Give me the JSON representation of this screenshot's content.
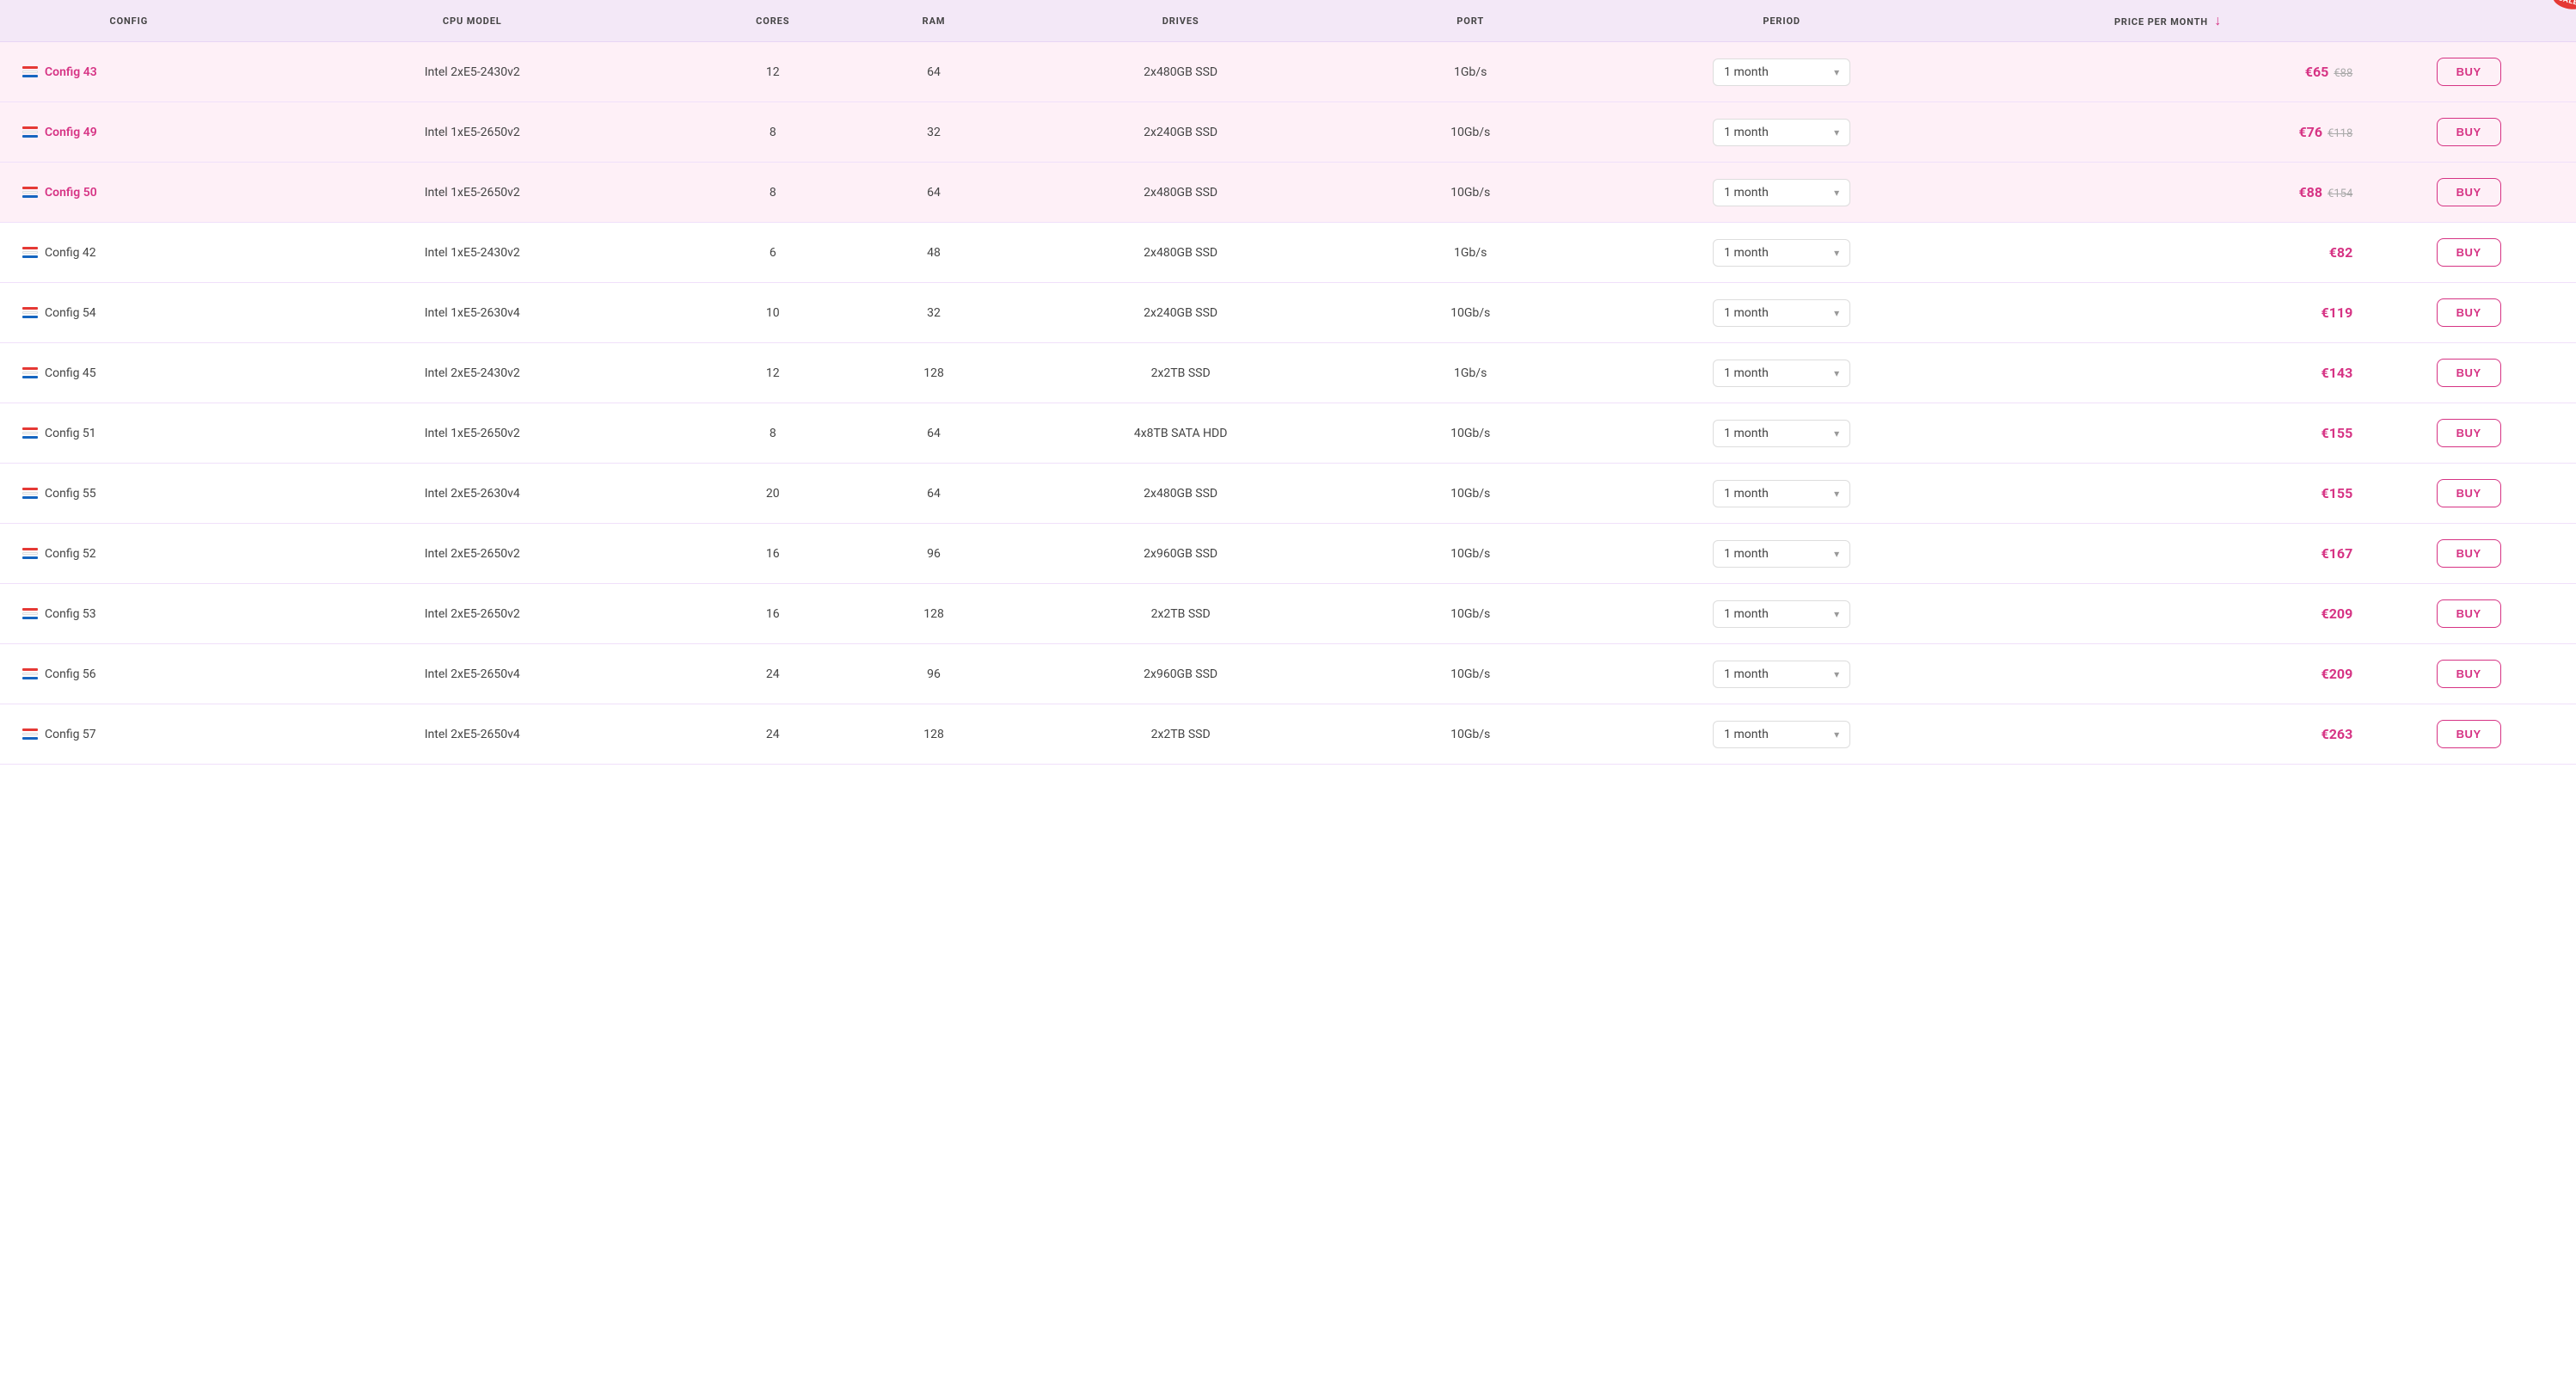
{
  "columns": {
    "config": "CONFIG",
    "cpu": "CPU MODEL",
    "cores": "CORES",
    "ram": "RAM",
    "drives": "DRIVES",
    "port": "PORT",
    "period": "PERIOD",
    "price": "PRICE PER MONTH"
  },
  "sale_badge": "Sale",
  "rows": [
    {
      "id": "config43",
      "config": "Config 43",
      "highlighted": true,
      "linked": true,
      "cpu": "Intel 2xE5-2430v2",
      "cores": "12",
      "ram": "64",
      "drives": "2x480GB SSD",
      "port": "1Gb/s",
      "period": "1 month",
      "price": "€65",
      "price_old": "€88",
      "buy": "BUY"
    },
    {
      "id": "config49",
      "config": "Config 49",
      "highlighted": true,
      "linked": true,
      "cpu": "Intel 1xE5-2650v2",
      "cores": "8",
      "ram": "32",
      "drives": "2x240GB SSD",
      "port": "10Gb/s",
      "period": "1 month",
      "price": "€76",
      "price_old": "€118",
      "buy": "BUY"
    },
    {
      "id": "config50",
      "config": "Config 50",
      "highlighted": true,
      "linked": true,
      "cpu": "Intel 1xE5-2650v2",
      "cores": "8",
      "ram": "64",
      "drives": "2x480GB SSD",
      "port": "10Gb/s",
      "period": "1 month",
      "price": "€88",
      "price_old": "€154",
      "buy": "BUY"
    },
    {
      "id": "config42",
      "config": "Config 42",
      "highlighted": false,
      "linked": false,
      "cpu": "Intel 1xE5-2430v2",
      "cores": "6",
      "ram": "48",
      "drives": "2x480GB SSD",
      "port": "1Gb/s",
      "period": "1 month",
      "price": "€82",
      "price_old": null,
      "buy": "BUY"
    },
    {
      "id": "config54",
      "config": "Config 54",
      "highlighted": false,
      "linked": false,
      "cpu": "Intel 1xE5-2630v4",
      "cores": "10",
      "ram": "32",
      "drives": "2x240GB SSD",
      "port": "10Gb/s",
      "period": "1 month",
      "price": "€119",
      "price_old": null,
      "buy": "BUY"
    },
    {
      "id": "config45",
      "config": "Config 45",
      "highlighted": false,
      "linked": false,
      "cpu": "Intel 2xE5-2430v2",
      "cores": "12",
      "ram": "128",
      "drives": "2x2TB SSD",
      "port": "1Gb/s",
      "period": "1 month",
      "price": "€143",
      "price_old": null,
      "buy": "BUY"
    },
    {
      "id": "config51",
      "config": "Config 51",
      "highlighted": false,
      "linked": false,
      "cpu": "Intel 1xE5-2650v2",
      "cores": "8",
      "ram": "64",
      "drives": "4x8TB SATA HDD",
      "port": "10Gb/s",
      "period": "1 month",
      "price": "€155",
      "price_old": null,
      "buy": "BUY"
    },
    {
      "id": "config55",
      "config": "Config 55",
      "highlighted": false,
      "linked": false,
      "cpu": "Intel 2xE5-2630v4",
      "cores": "20",
      "ram": "64",
      "drives": "2x480GB SSD",
      "port": "10Gb/s",
      "period": "1 month",
      "price": "€155",
      "price_old": null,
      "buy": "BUY"
    },
    {
      "id": "config52",
      "config": "Config 52",
      "highlighted": false,
      "linked": false,
      "cpu": "Intel 2xE5-2650v2",
      "cores": "16",
      "ram": "96",
      "drives": "2x960GB SSD",
      "port": "10Gb/s",
      "period": "1 month",
      "price": "€167",
      "price_old": null,
      "buy": "BUY"
    },
    {
      "id": "config53",
      "config": "Config 53",
      "highlighted": false,
      "linked": false,
      "cpu": "Intel 2xE5-2650v2",
      "cores": "16",
      "ram": "128",
      "drives": "2x2TB SSD",
      "port": "10Gb/s",
      "period": "1 month",
      "price": "€209",
      "price_old": null,
      "buy": "BUY"
    },
    {
      "id": "config56",
      "config": "Config 56",
      "highlighted": false,
      "linked": false,
      "cpu": "Intel 2xE5-2650v4",
      "cores": "24",
      "ram": "96",
      "drives": "2x960GB SSD",
      "port": "10Gb/s",
      "period": "1 month",
      "price": "€209",
      "price_old": null,
      "buy": "BUY"
    },
    {
      "id": "config57",
      "config": "Config 57",
      "highlighted": false,
      "linked": false,
      "cpu": "Intel 2xE5-2650v4",
      "cores": "24",
      "ram": "128",
      "drives": "2x2TB SSD",
      "port": "10Gb/s",
      "period": "1 month",
      "price": "€263",
      "price_old": null,
      "buy": "BUY"
    }
  ]
}
